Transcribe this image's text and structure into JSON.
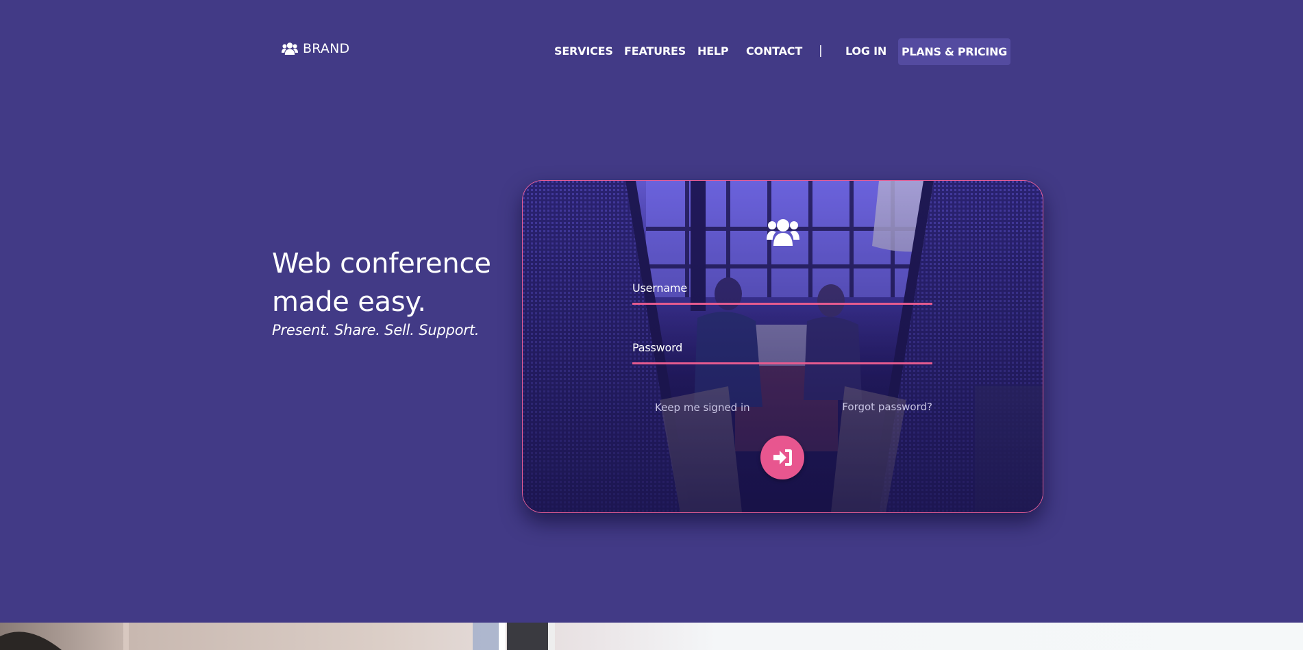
{
  "brand": {
    "name": "BRAND",
    "icon": "users-icon"
  },
  "nav": {
    "items": [
      {
        "label": "SERVICES"
      },
      {
        "label": "FEATURES"
      },
      {
        "label": "HELP"
      },
      {
        "label": "CONTACT"
      }
    ],
    "separator": "|",
    "login_label": "LOG IN",
    "plans_label": "PLANS & PRICING"
  },
  "hero": {
    "title_line1": "Web conference",
    "title_line2": "made easy.",
    "subtitle": "Present. Share. Sell. Support."
  },
  "login": {
    "icon": "users-icon",
    "username_label": "Username",
    "username_value": "",
    "password_label": "Password",
    "password_value": "",
    "keep_signed_in": "Keep me signed in",
    "forgot_password": "Forgot password?",
    "submit_icon": "sign-in-icon"
  },
  "colors": {
    "background": "#423a86",
    "accent": "#e8568f",
    "plans_button": "#544ba0"
  }
}
